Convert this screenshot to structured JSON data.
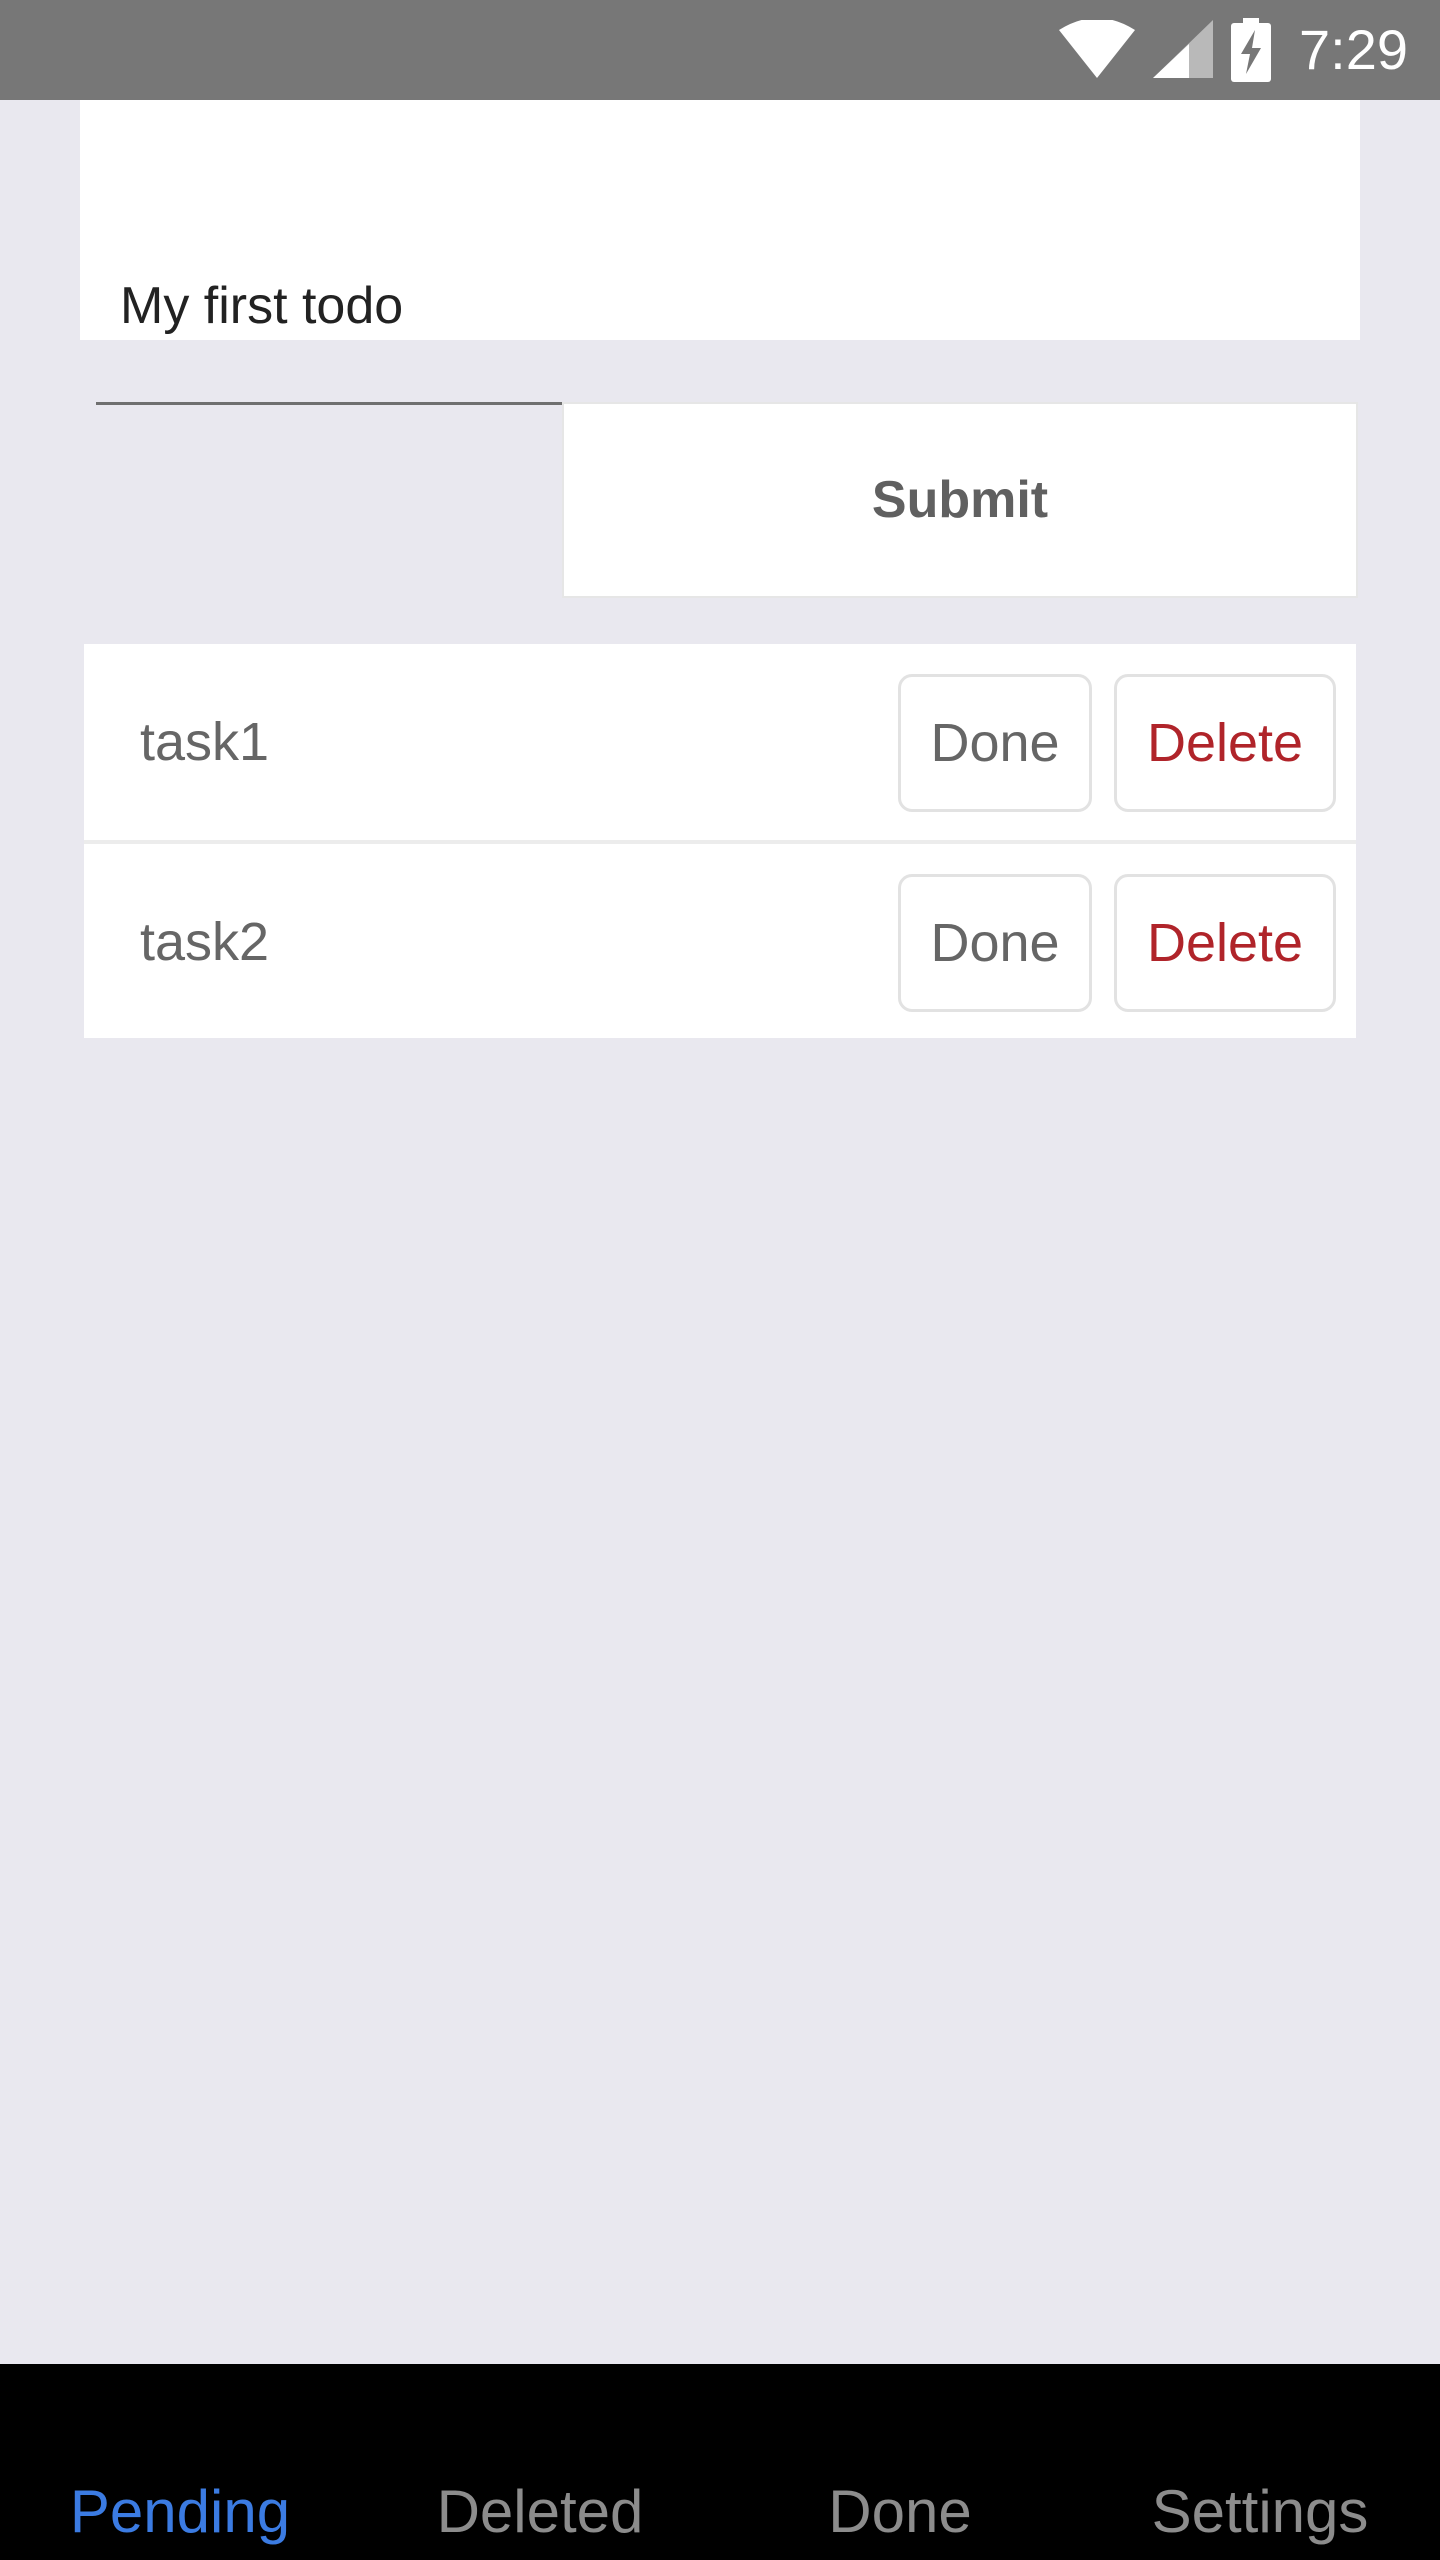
{
  "status_bar": {
    "time": "7:29",
    "icons": [
      "wifi-icon",
      "signal-icon",
      "battery-charging-icon"
    ]
  },
  "todo_input": {
    "value": "My first todo"
  },
  "submit": {
    "label": "Submit"
  },
  "tasks": [
    {
      "label": "task1",
      "done_label": "Done",
      "delete_label": "Delete"
    },
    {
      "label": "task2",
      "done_label": "Done",
      "delete_label": "Delete"
    }
  ],
  "tabs": [
    {
      "label": "Pending",
      "active": true
    },
    {
      "label": "Deleted",
      "active": false
    },
    {
      "label": "Done",
      "active": false
    },
    {
      "label": "Settings",
      "active": false
    }
  ],
  "colors": {
    "accent": "#3b7be2",
    "delete": "#b0242a",
    "status_bar": "#777777",
    "background": "#e9e8ef",
    "tab_bar": "#000000"
  }
}
